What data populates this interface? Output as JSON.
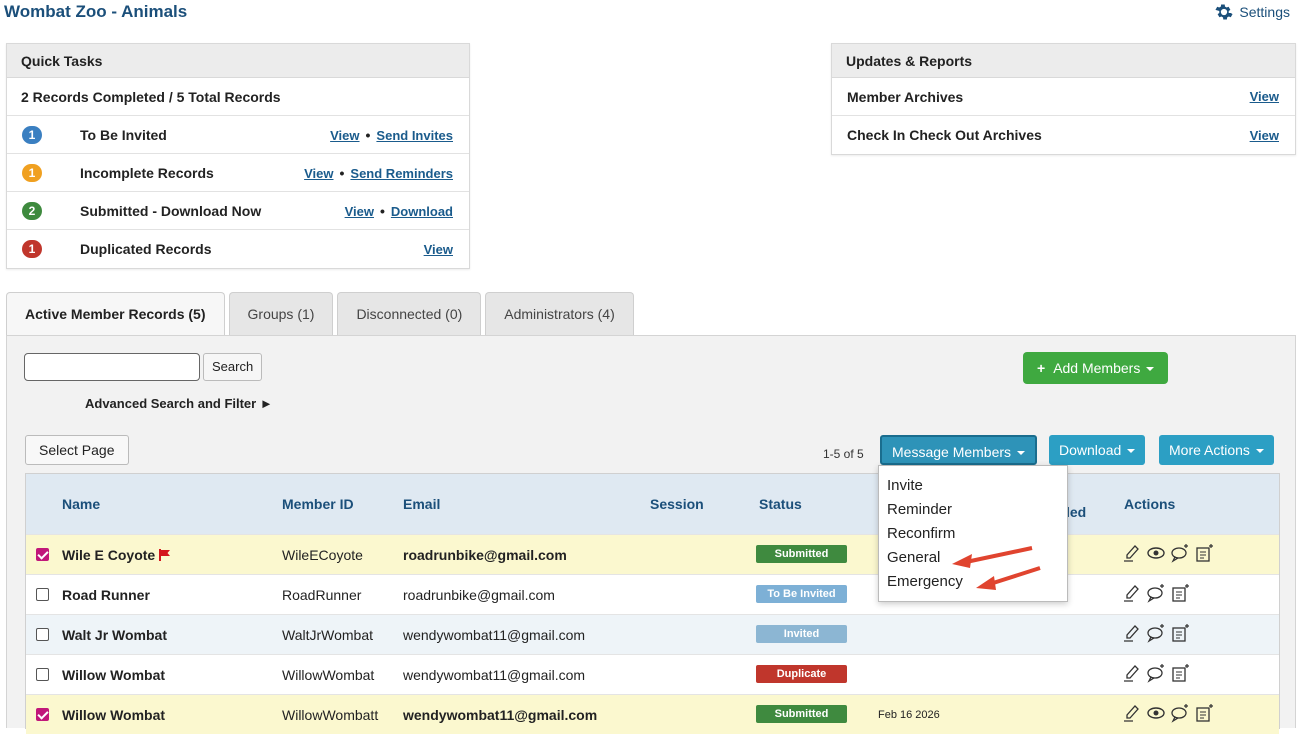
{
  "header": {
    "title": "Wombat Zoo - Animals",
    "settings_label": "Settings"
  },
  "quick_tasks": {
    "title": "Quick Tasks",
    "summary": "2 Records Completed / 5 Total Records",
    "rows": [
      {
        "count": "1",
        "color": "#3a7fc1",
        "label": "To Be Invited",
        "action1": "View",
        "sep": "•",
        "action2": "Send Invites"
      },
      {
        "count": "1",
        "color": "#f0a020",
        "label": "Incomplete Records",
        "action1": "View",
        "sep": "•",
        "action2": "Send Reminders"
      },
      {
        "count": "2",
        "color": "#3e8a3e",
        "label": "Submitted - Download Now",
        "action1": "View",
        "sep": "•",
        "action2": "Download"
      },
      {
        "count": "1",
        "color": "#c0362c",
        "label": "Duplicated Records",
        "action1": "View"
      }
    ]
  },
  "updates": {
    "title": "Updates & Reports",
    "rows": [
      {
        "label": "Member Archives",
        "action": "View"
      },
      {
        "label": "Check In Check Out Archives",
        "action": "View"
      }
    ]
  },
  "tabs": [
    {
      "label": "Active Member Records (5)",
      "active": true
    },
    {
      "label": "Groups (1)"
    },
    {
      "label": "Disconnected (0)"
    },
    {
      "label": "Administrators (4)"
    }
  ],
  "toolbar": {
    "search_label": "Search",
    "advanced_label": "Advanced Search and Filter ►",
    "add_members_label": "Add Members",
    "select_page_label": "Select Page",
    "pager": "1-5 of 5",
    "message_members_label": "Message Members",
    "download_label": "Download",
    "more_actions_label": "More Actions"
  },
  "table": {
    "headers": {
      "name": "Name",
      "member_id": "Member ID",
      "email": "Email",
      "session": "Session",
      "status": "Status",
      "submitted": "led",
      "actions": "Actions"
    },
    "rows": [
      {
        "checked": true,
        "name": "Wile E Coyote",
        "member_id": "WileECoyote",
        "email": "roadrunbike@gmail.com",
        "status": "Submitted",
        "date": "",
        "flag": true
      },
      {
        "checked": false,
        "name": "Road Runner",
        "member_id": "RoadRunner",
        "email": "roadrunbike@gmail.com",
        "status": "To Be Invited",
        "date": ""
      },
      {
        "checked": false,
        "name": "Walt Jr Wombat",
        "member_id": "WaltJrWombat",
        "email": "wendywombat11@gmail.com",
        "status": "Invited",
        "date": ""
      },
      {
        "checked": false,
        "name": "Willow Wombat",
        "member_id": "WillowWombat",
        "email": "wendywombat11@gmail.com",
        "status": "Duplicate",
        "date": ""
      },
      {
        "checked": true,
        "name": "Willow Wombat",
        "member_id": "WillowWombatt",
        "email": "wendywombat11@gmail.com",
        "status": "Submitted",
        "date": "Feb 16 2026"
      }
    ]
  },
  "message_menu": {
    "items": [
      "Invite",
      "Reminder",
      "Reconfirm",
      "General",
      "Emergency"
    ]
  },
  "colors": {
    "accent": "#2c9fc4",
    "add": "#3fa940",
    "annotation": "#e0442f"
  }
}
